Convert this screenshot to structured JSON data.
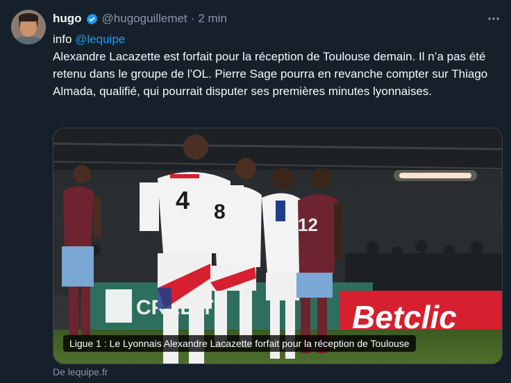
{
  "tweet": {
    "display_name": "hugo",
    "handle": "@hugoguillemet",
    "separator": "·",
    "time": "2 min",
    "more_icon": "more-horizontal-icon",
    "verified_color": "#1d9bf0",
    "text_prefix": "info ",
    "mention": "@lequipe",
    "body": "Alexandre Lacazette est forfait pour la réception de Toulouse demain. Il n’a pas été retenu dans le groupe de l’OL. Pierre Sage pourra en revanche compter sur Thiago Almada, qualifié, qui pourrait disputer ses premières minutes lyonnaises."
  },
  "card": {
    "caption": "Ligue 1 : Le Lyonnais Alexandre Lacazette forfait pour la réception de Toulouse",
    "source": "De lequipe.fr",
    "image_text": {
      "ad_brand": "Betclic",
      "ad_left": "CRÉDIT",
      "shirt_numbers": [
        "4",
        "8",
        "12"
      ]
    }
  },
  "colors": {
    "background": "#15202b",
    "text": "#f7f9f9",
    "muted": "#8b98a5",
    "accent": "#1d9bf0",
    "betclic_red": "#d6202f"
  }
}
